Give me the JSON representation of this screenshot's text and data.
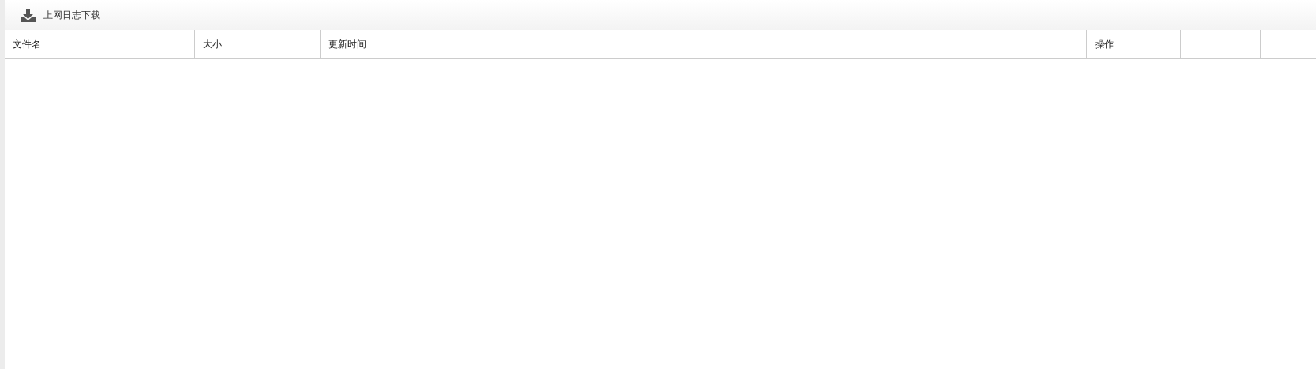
{
  "toolbar": {
    "title": "上网日志下载"
  },
  "table": {
    "columns": [
      "文件名",
      "大小",
      "更新时间",
      "操作"
    ]
  }
}
